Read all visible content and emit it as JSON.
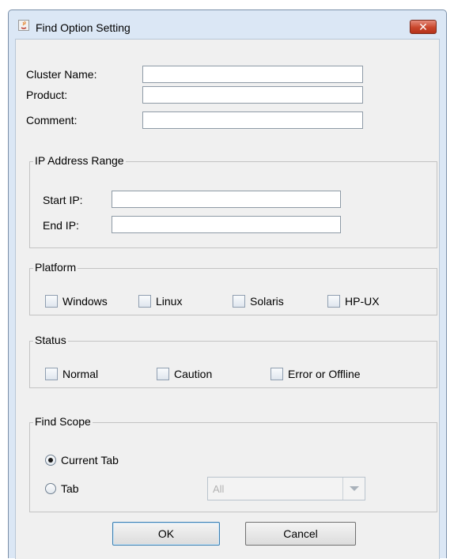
{
  "window": {
    "title": "Find Option Setting",
    "close_glyph": "✕",
    "icon": "java-icon"
  },
  "fields": {
    "cluster_name": {
      "label": "Cluster Name:",
      "value": ""
    },
    "product": {
      "label": "Product:",
      "value": ""
    },
    "comment": {
      "label": "Comment:",
      "value": ""
    }
  },
  "ip_range": {
    "title": "IP Address Range",
    "start": {
      "label": "Start IP:",
      "value": ""
    },
    "end": {
      "label": "End IP:",
      "value": ""
    }
  },
  "platform": {
    "title": "Platform",
    "options": [
      {
        "label": "Windows",
        "checked": false
      },
      {
        "label": "Linux",
        "checked": false
      },
      {
        "label": "Solaris",
        "checked": false
      },
      {
        "label": "HP-UX",
        "checked": false
      }
    ]
  },
  "status": {
    "title": "Status",
    "options": [
      {
        "label": "Normal",
        "checked": false
      },
      {
        "label": "Caution",
        "checked": false
      },
      {
        "label": "Error or Offline",
        "checked": false
      }
    ]
  },
  "find_scope": {
    "title": "Find Scope",
    "current_tab": {
      "label": "Current Tab",
      "selected": true
    },
    "tab": {
      "label": "Tab",
      "selected": false
    },
    "tab_select": {
      "value": "All",
      "enabled": false
    }
  },
  "buttons": {
    "ok": "OK",
    "cancel": "Cancel"
  }
}
